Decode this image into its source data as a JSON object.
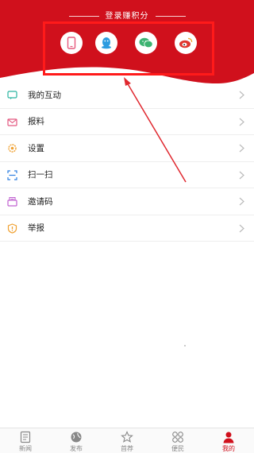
{
  "colors": {
    "brand": "#d0101c",
    "highlight": "#ff1a1a",
    "annotation_arrow": "#e0282f"
  },
  "header": {
    "login_title": "登录赚积分",
    "login_methods": [
      {
        "name": "phone",
        "icon": "phone-icon",
        "color": "#e6587d"
      },
      {
        "name": "qq",
        "icon": "qq-penguin-icon",
        "color": "#2d9ce0"
      },
      {
        "name": "wechat",
        "icon": "wechat-icon",
        "color": "#3cb371"
      },
      {
        "name": "weibo",
        "icon": "weibo-icon",
        "color": "#e0372f"
      }
    ]
  },
  "menu": {
    "items": [
      {
        "label": "我的互动",
        "icon": "chat-icon",
        "color": "#2ab5a0"
      },
      {
        "label": "报料",
        "icon": "mail-icon",
        "color": "#e3577f"
      },
      {
        "label": "设置",
        "icon": "gear-icon",
        "color": "#f0a030"
      },
      {
        "label": "扫一扫",
        "icon": "scan-icon",
        "color": "#2d7fe0"
      },
      {
        "label": "邀请码",
        "icon": "invite-icon",
        "color": "#c060d0"
      },
      {
        "label": "举报",
        "icon": "alert-icon",
        "color": "#f0a030"
      }
    ]
  },
  "tabbar": {
    "tabs": [
      {
        "label": "新闻",
        "icon": "newspaper-icon",
        "active": false
      },
      {
        "label": "发布",
        "icon": "globe-icon",
        "active": false
      },
      {
        "label": "首荐",
        "icon": "star-icon",
        "active": false
      },
      {
        "label": "便民",
        "icon": "grid-icon",
        "active": false
      },
      {
        "label": "我的",
        "icon": "user-icon",
        "active": true
      }
    ]
  }
}
